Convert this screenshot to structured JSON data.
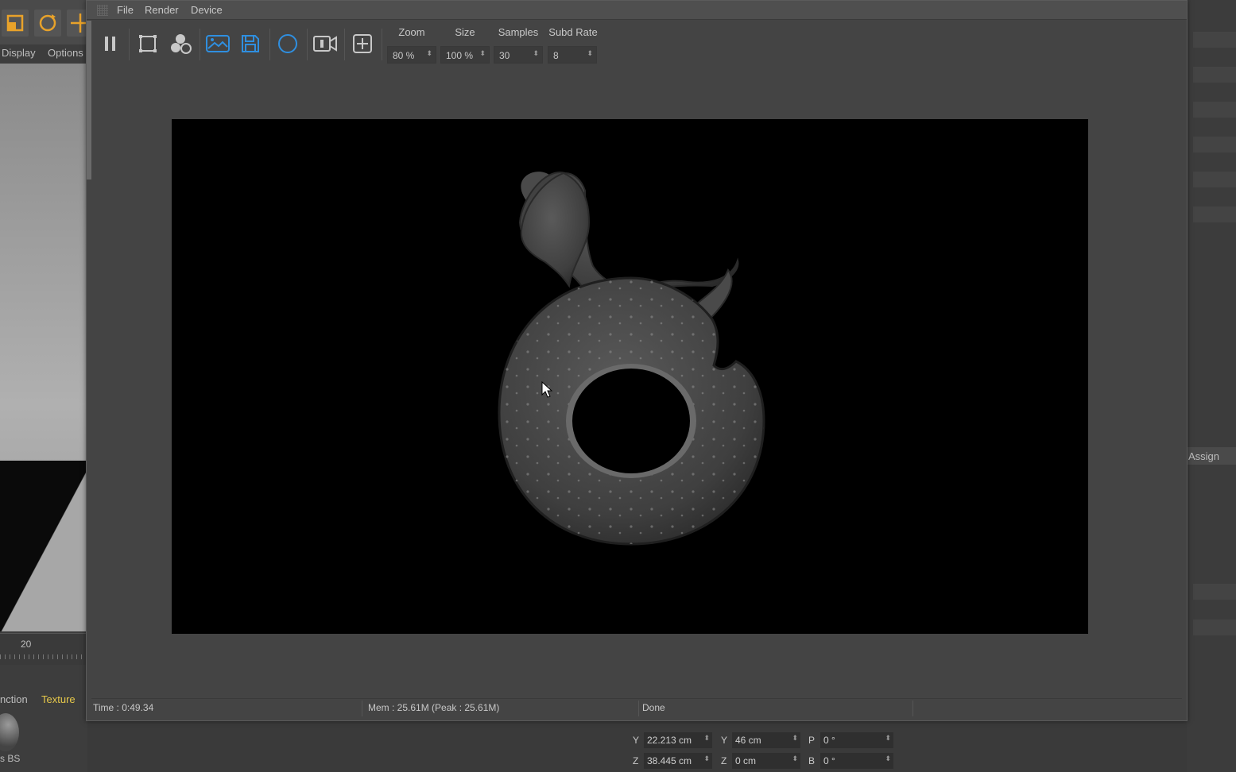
{
  "background_app": {
    "menu": [
      "Display",
      "Options"
    ],
    "timeline_frame": "20",
    "material_tabs": [
      "nction",
      "Texture"
    ],
    "material_label": "s BS",
    "right_panel_button": "Assign",
    "coordinates": {
      "rows": [
        {
          "axis": "Y",
          "position": "22.213 cm",
          "size_axis": "Y",
          "size": "46 cm",
          "rot_axis": "P",
          "rotation": "0 °"
        },
        {
          "axis": "Z",
          "position": "38.445 cm",
          "size_axis": "Z",
          "size": "0 cm",
          "rot_axis": "B",
          "rotation": "0 °"
        }
      ]
    }
  },
  "render_window": {
    "menu": [
      "File",
      "Render",
      "Device"
    ],
    "toolbar": {
      "icons": [
        "pause-icon",
        "region-crop-icon",
        "objects-icon",
        "picture-viewer-icon",
        "save-icon",
        "sphere-icon",
        "camera-icon",
        "focus-pick-icon"
      ],
      "params": [
        {
          "label": "Zoom",
          "value": "80 %"
        },
        {
          "label": "Size",
          "value": "100 %"
        },
        {
          "label": "Samples",
          "value": "30"
        },
        {
          "label": "Subd Rate",
          "value": "8"
        }
      ]
    },
    "status": {
      "time": "Time : 0:49.34",
      "mem": "Mem : 25.61M (Peak : 25.61M)",
      "state": "Done"
    }
  },
  "colors": {
    "accent_blue": "#2f8fe0",
    "accent_orange": "#e8a22a",
    "render_background": "#000000",
    "panel": "#444444"
  }
}
